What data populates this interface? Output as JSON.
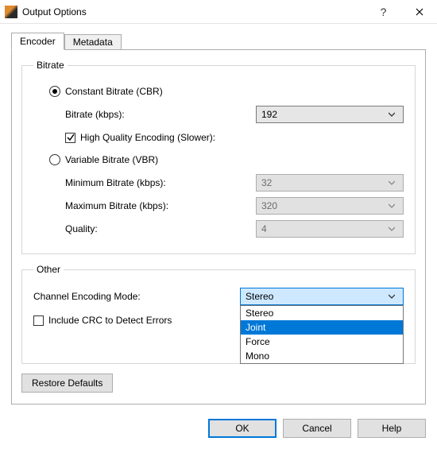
{
  "window": {
    "title": "Output Options"
  },
  "tabs": {
    "encoder": "Encoder",
    "metadata": "Metadata"
  },
  "bitrate_group": {
    "legend": "Bitrate",
    "cbr_label": "Constant Bitrate (CBR)",
    "bitrate_label": "Bitrate (kbps):",
    "bitrate_value": "192",
    "hq_label": "High Quality Encoding (Slower):",
    "vbr_label": "Variable Bitrate (VBR)",
    "min_label": "Minimum Bitrate (kbps):",
    "min_value": "32",
    "max_label": "Maximum Bitrate (kbps):",
    "max_value": "320",
    "quality_label": "Quality:",
    "quality_value": "4"
  },
  "other_group": {
    "legend": "Other",
    "channel_label": "Channel Encoding Mode:",
    "channel_value": "Stereo",
    "channel_options": {
      "o0": "Stereo",
      "o1": "Joint",
      "o2": "Force",
      "o3": "Mono"
    },
    "crc_label": "Include CRC to Detect Errors"
  },
  "buttons": {
    "restore": "Restore Defaults",
    "ok": "OK",
    "cancel": "Cancel",
    "help": "Help"
  }
}
